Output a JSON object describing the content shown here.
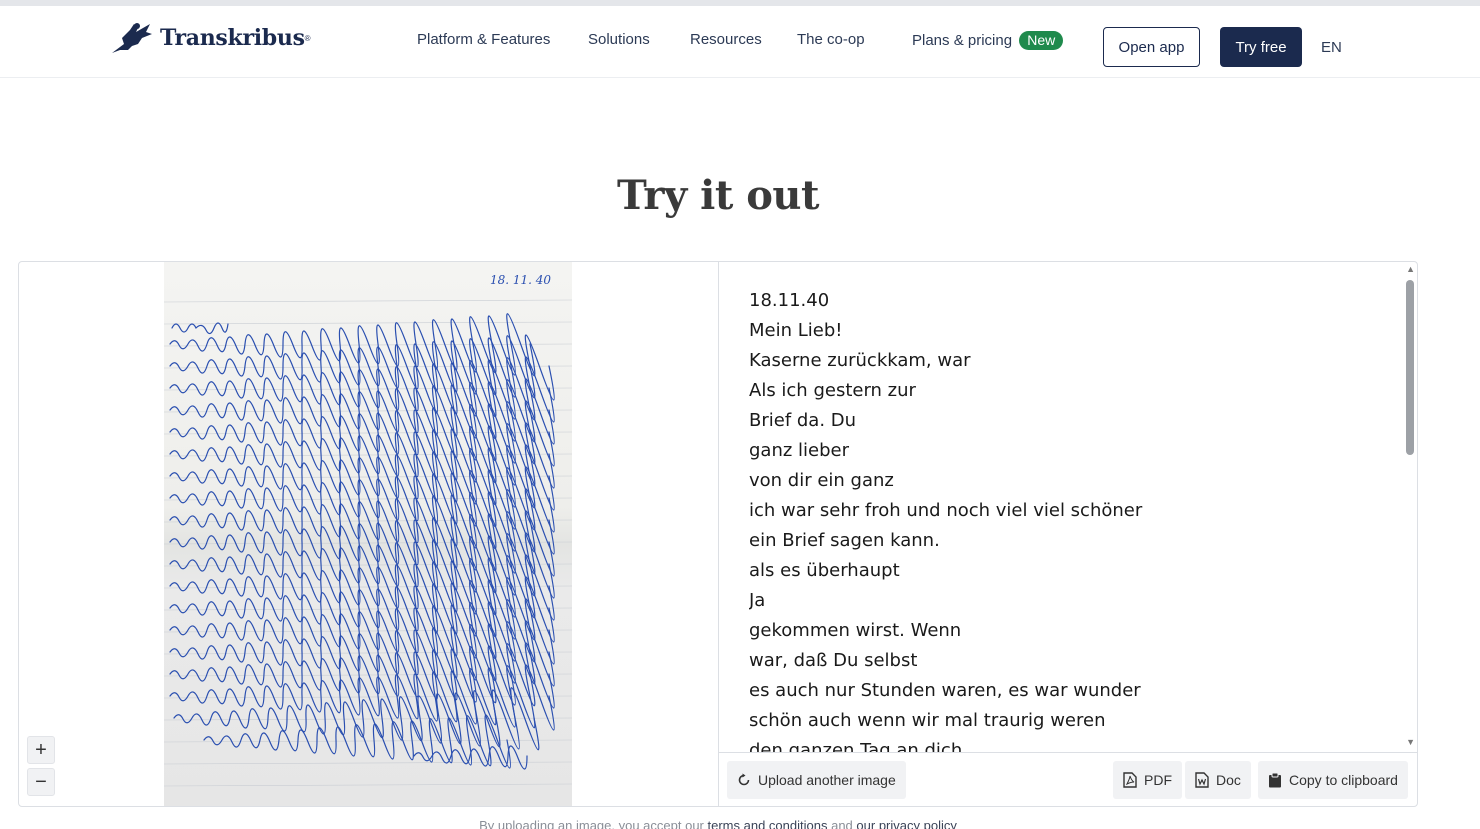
{
  "brand": {
    "name": "Transkribus",
    "reg": "®"
  },
  "nav": {
    "platform": "Platform & Features",
    "solutions": "Solutions",
    "resources": "Resources",
    "coop": "The co-op",
    "pricing": "Plans & pricing",
    "pricing_badge": "New",
    "open_app": "Open app",
    "try_free": "Try free",
    "lang": "EN"
  },
  "main": {
    "title": "Try it out"
  },
  "viewer": {
    "image_date": "18. 11. 40",
    "zoom_in": "+",
    "zoom_out": "−"
  },
  "transcript": {
    "lines": [
      "18.11.40",
      "Mein Lieb!",
      "Kaserne zurückkam, war",
      "Als ich gestern zur",
      "Brief da. Du",
      "ganz lieber",
      "von dir ein ganz",
      "ich war sehr froh und noch viel viel schöner",
      "ein Brief sagen kann.",
      "als es überhaupt",
      "Ja",
      "gekommen wirst. Wenn",
      "war, daß Du selbst",
      "es auch nur Stunden waren, es war wunder",
      "schön auch wenn wir mal traurig weren",
      "den ganzen Tag an dich"
    ]
  },
  "actions": {
    "upload": "Upload another image",
    "pdf": "PDF",
    "doc": "Doc",
    "copy": "Copy to clipboard"
  },
  "footer": {
    "prefix": "By uploading an image, you accept our",
    "terms": "terms and conditions",
    "and": "and",
    "privacy": "our privacy policy"
  },
  "colors": {
    "brand_navy": "#1b2a4e",
    "badge_green": "#1f8a4c",
    "ink_blue": "#2a4fb0"
  }
}
